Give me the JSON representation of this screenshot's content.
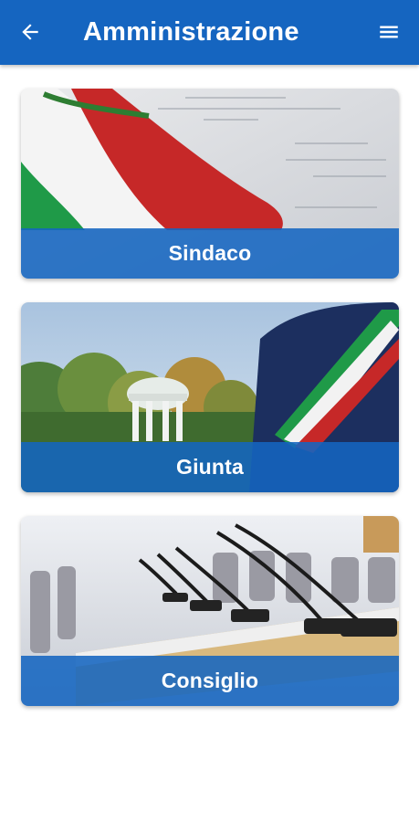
{
  "app_bar": {
    "title": "Amministrazione",
    "back_icon": "arrow-left-icon",
    "menu_icon": "hamburger-menu-icon",
    "color": "#1565c0"
  },
  "cards": [
    {
      "label": "Sindaco",
      "image": "italian-flag-sash-on-document"
    },
    {
      "label": "Giunta",
      "image": "tricolor-sash-and-park-temple"
    },
    {
      "label": "Consiglio",
      "image": "council-chamber-microphones"
    }
  ],
  "colors": {
    "banner": "#1565c0",
    "flag_green": "#1f9a48",
    "flag_red": "#d32f2f"
  }
}
